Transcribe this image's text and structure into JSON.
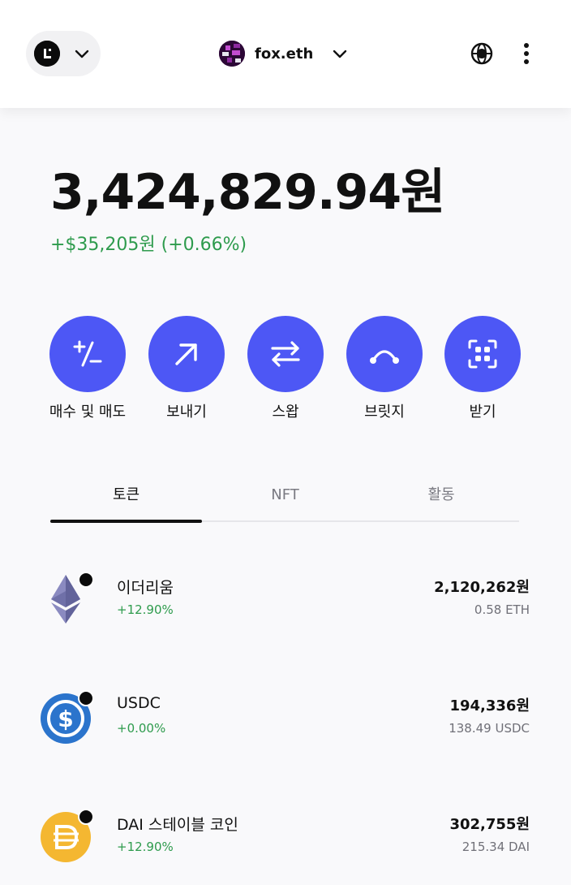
{
  "header": {
    "chain_icon": "lens-chain-logo",
    "chevron_icon": "chevron-down-icon",
    "account": {
      "name": "fox.eth",
      "avatar_icon": "pixel-avatar"
    },
    "globe_icon": "globe-icon",
    "more_icon": "more-vertical-icon"
  },
  "portfolio": {
    "balance": "3,424,829.94원",
    "change": "+$35,205원 (+0.66%)",
    "change_color": "#2e9b4d"
  },
  "actions": [
    {
      "label": "매수 및 매도",
      "icon": "plus-minus-icon"
    },
    {
      "label": "보내기",
      "icon": "arrow-up-right-icon"
    },
    {
      "label": "스왑",
      "icon": "swap-arrows-icon"
    },
    {
      "label": "브릿지",
      "icon": "bridge-arc-icon"
    },
    {
      "label": "받기",
      "icon": "qr-scan-icon"
    }
  ],
  "accent_color": "#4d57f5",
  "tabs": [
    {
      "label": "토큰",
      "active": true
    },
    {
      "label": "NFT",
      "active": false
    },
    {
      "label": "활동",
      "active": false
    }
  ],
  "tokens": [
    {
      "name": "이더리움",
      "change": "+12.90%",
      "value": "2,120,262원",
      "amount": "0.58 ETH",
      "icon": "ethereum-logo"
    },
    {
      "name": "USDC",
      "change": "+0.00%",
      "value": "194,336원",
      "amount": "138.49 USDC",
      "icon": "usdc-logo"
    },
    {
      "name": "DAI 스테이블 코인",
      "change": "+12.90%",
      "value": "302,755원",
      "amount": "215.34 DAI",
      "icon": "dai-logo"
    }
  ]
}
